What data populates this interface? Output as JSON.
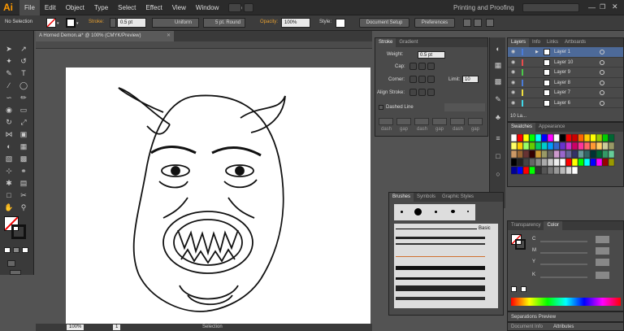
{
  "app": {
    "logo": "Ai",
    "workspace": "Printing and Proofing"
  },
  "menu": [
    "File",
    "Edit",
    "Object",
    "Type",
    "Select",
    "Effect",
    "View",
    "Window",
    "Help"
  ],
  "control_bar": {
    "selection": "No Selection",
    "stroke_label": "Stroke:",
    "stroke_weight": "0.5 pt",
    "profile": "Uniform",
    "brush": "5 pt. Round",
    "opacity_label": "Opacity:",
    "opacity": "100%",
    "style_label": "Style:",
    "document_setup": "Document Setup",
    "preferences": "Preferences"
  },
  "document": {
    "tab": "A Horned Demon.ai* @ 100% (CMYK/Preview)"
  },
  "status": {
    "zoom": "100%",
    "page": "1",
    "mode": "Selection"
  },
  "stroke_panel": {
    "tabs": [
      "Stroke",
      "Gradient"
    ],
    "weight_label": "Weight:",
    "weight": "0.5 pt",
    "cap_label": "Cap:",
    "corner_label": "Corner:",
    "limit_label": "Limit:",
    "limit": "10",
    "align_label": "Align Stroke:",
    "dashed_label": "Dashed Line",
    "dash_labels": [
      "dash",
      "gap",
      "dash",
      "gap",
      "dash",
      "gap"
    ]
  },
  "layers_panel": {
    "tabs": [
      "Layers",
      "Info",
      "Links",
      "Artboards"
    ],
    "layers": [
      {
        "name": "Layer 1",
        "color": "#4a7bd8",
        "active": true
      },
      {
        "name": "Layer 10",
        "color": "#e84c4c",
        "active": false
      },
      {
        "name": "Layer 9",
        "color": "#4ac84a",
        "active": false
      },
      {
        "name": "Layer 8",
        "color": "#4a7bd8",
        "active": false
      },
      {
        "name": "Layer 7",
        "color": "#f0e040",
        "active": false
      },
      {
        "name": "Layer 6",
        "color": "#40d8e8",
        "active": false
      }
    ],
    "count": "10 La..."
  },
  "swatches_panel": {
    "tabs": [
      "Swatches",
      "Appearance"
    ]
  },
  "brushes_panel": {
    "tabs": [
      "Brushes",
      "Symbols",
      "Graphic Styles"
    ],
    "basic_label": "Basic"
  },
  "transparency_panel": {
    "tabs": [
      "Transparency",
      "Color"
    ],
    "channels": [
      "C",
      "M",
      "Y",
      "K"
    ]
  },
  "separations_panel": {
    "title": "Separations Preview"
  },
  "doc_info_panel": {
    "tabs": [
      "Document Info",
      "Attributes"
    ]
  }
}
